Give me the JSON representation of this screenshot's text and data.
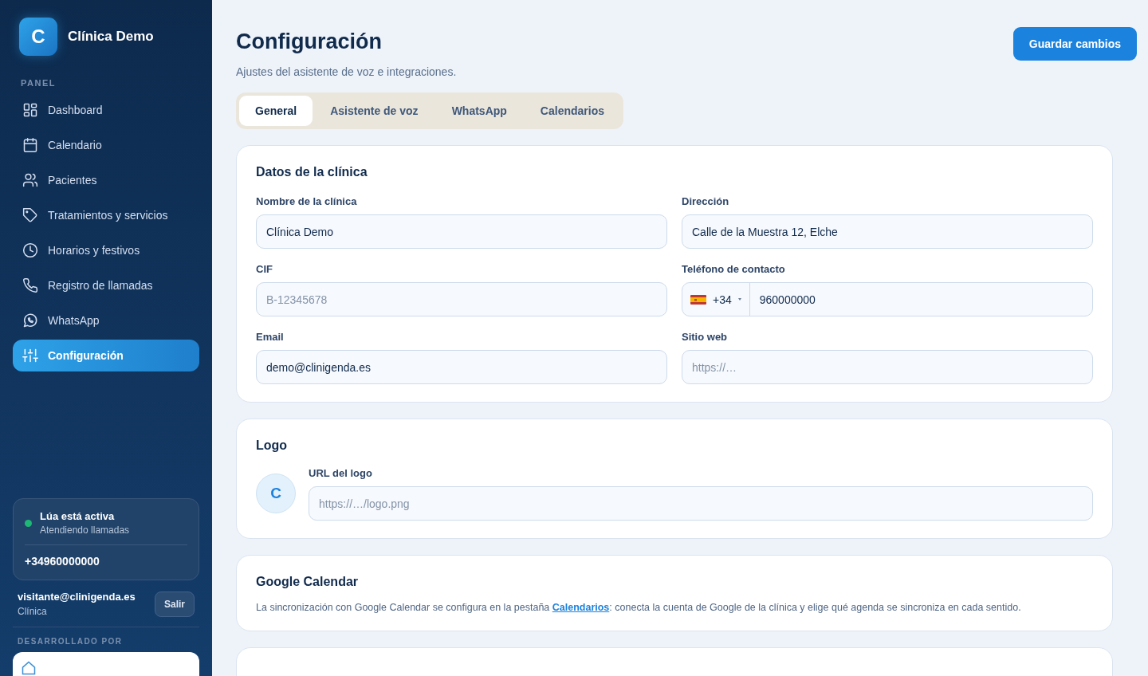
{
  "sidebar": {
    "logo_letter": "C",
    "brand": "Clínica Demo",
    "section_label": "PANEL",
    "items": [
      {
        "label": "Dashboard",
        "selected": false
      },
      {
        "label": "Calendario",
        "selected": false
      },
      {
        "label": "Pacientes",
        "selected": false
      },
      {
        "label": "Tratamientos y servicios",
        "selected": false
      },
      {
        "label": "Horarios y festivos",
        "selected": false
      },
      {
        "label": "Registro de llamadas",
        "selected": false
      },
      {
        "label": "WhatsApp",
        "selected": false
      },
      {
        "label": "Configuración",
        "selected": true
      }
    ],
    "assistant": {
      "active": true,
      "title": "Lúa está activa",
      "subtitle": "Atendiendo llamadas",
      "phone": "+34960000000"
    },
    "user": {
      "email": "visitante@clinigenda.es",
      "role": "Clínica",
      "logout": "Salir"
    },
    "credit_label": "DESARROLLADO POR"
  },
  "header": {
    "title": "Configuración",
    "subtitle": "Ajustes del asistente de voz e integraciones.",
    "save_button": "Guardar cambios"
  },
  "tabs": [
    {
      "label": "General",
      "selected": true
    },
    {
      "label": "Asistente de voz",
      "selected": false
    },
    {
      "label": "WhatsApp",
      "selected": false
    },
    {
      "label": "Calendarios",
      "selected": false
    }
  ],
  "clinic_card": {
    "title": "Datos de la clínica",
    "fields": [
      {
        "kind": "text",
        "label": "Nombre de la clínica",
        "value": "Clínica Demo"
      },
      {
        "kind": "text",
        "label": "Dirección",
        "value": "Calle de la Muestra 12, Elche"
      },
      {
        "kind": "text",
        "label": "CIF",
        "placeholder": "B-12345678"
      },
      {
        "kind": "phone",
        "label": "Teléfono de contacto",
        "country_code": "+34",
        "value": "960000000"
      },
      {
        "kind": "text",
        "label": "Email",
        "value": "demo@clinigenda.es"
      },
      {
        "kind": "text",
        "label": "Sitio web",
        "placeholder": "https://…"
      }
    ]
  },
  "logo_card": {
    "title": "Logo",
    "avatar_letter": "C",
    "label": "URL del logo",
    "placeholder": "https://…/logo.png"
  },
  "google_card": {
    "title": "Google Calendar",
    "text_before": "La sincronización con Google Calendar se configura en la pestaña ",
    "link": "Calendarios",
    "text_after": ": conecta la cuenta de Google de la clínica y elige qué agenda se sincroniza en cada sentido."
  }
}
